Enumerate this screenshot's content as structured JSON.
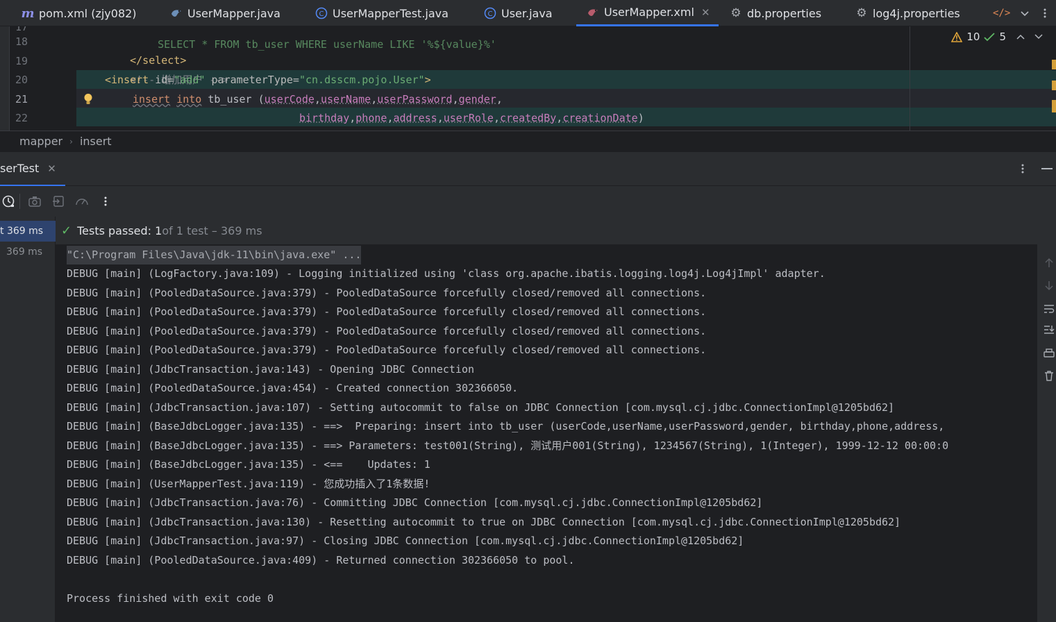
{
  "tabs": [
    {
      "label": "pom.xml (zjy082)",
      "icon": "maven-m-icon"
    },
    {
      "label": "UserMapper.java",
      "icon": "mybatis-bird-icon"
    },
    {
      "label": "UserMapperTest.java",
      "icon": "class-c-icon"
    },
    {
      "label": "User.java",
      "icon": "class-c-icon"
    },
    {
      "label": "UserMapper.xml",
      "icon": "mybatis-bird-icon",
      "active": true
    },
    {
      "label": "db.properties",
      "icon": "gear-icon"
    },
    {
      "label": "log4j.properties",
      "icon": "gear-icon"
    }
  ],
  "editor": {
    "inspections": {
      "warnings": "10",
      "checks": "5"
    },
    "line_numbers": [
      "17",
      "18",
      "19",
      "20",
      "21",
      "22"
    ],
    "lines": {
      "l17": "SELECT * FROM tb_user WHERE userName LIKE '%${value}%'",
      "l18_tag": "</select>",
      "l19_comment": "<!-- 增加用户 -->",
      "l20_open": "<insert ",
      "l20_attr1": "id=",
      "l20_val1": "\"add\"",
      "l20_attr2": " parameterType=",
      "l20_val2": "\"cn.dsscm.pojo.User\"",
      "l20_close": ">",
      "l21_kw1": "insert",
      "l21_kw2": "into",
      "l21_table": " tb_user (",
      "l21_c1": "userCode",
      "l21_c2": "userName",
      "l21_c3": "userPassword",
      "l21_c4": "gender",
      "l22_c1": "birthday",
      "l22_c2": "phone",
      "l22_c3": "address",
      "l22_c4": "userRole",
      "l22_c5": "createdBy",
      "l22_c6": "creationDate"
    }
  },
  "breadcrumb": [
    "mapper",
    "insert"
  ],
  "run": {
    "tab_label": "serTest",
    "tree": [
      {
        "label": "t 369 ms"
      },
      {
        "label": "369 ms"
      }
    ],
    "status": {
      "passed": "Tests passed: 1",
      "detail": " of 1 test – 369 ms"
    },
    "console": [
      "\"C:\\Program Files\\Java\\jdk-11\\bin\\java.exe\" ...",
      "DEBUG [main] (LogFactory.java:109) - Logging initialized using 'class org.apache.ibatis.logging.log4j.Log4jImpl' adapter.",
      "DEBUG [main] (PooledDataSource.java:379) - PooledDataSource forcefully closed/removed all connections.",
      "DEBUG [main] (PooledDataSource.java:379) - PooledDataSource forcefully closed/removed all connections.",
      "DEBUG [main] (PooledDataSource.java:379) - PooledDataSource forcefully closed/removed all connections.",
      "DEBUG [main] (PooledDataSource.java:379) - PooledDataSource forcefully closed/removed all connections.",
      "DEBUG [main] (JdbcTransaction.java:143) - Opening JDBC Connection",
      "DEBUG [main] (PooledDataSource.java:454) - Created connection 302366050.",
      "DEBUG [main] (JdbcTransaction.java:107) - Setting autocommit to false on JDBC Connection [com.mysql.cj.jdbc.ConnectionImpl@1205bd62]",
      "DEBUG [main] (BaseJdbcLogger.java:135) - ==>  Preparing: insert into tb_user (userCode,userName,userPassword,gender, birthday,phone,address,",
      "DEBUG [main] (BaseJdbcLogger.java:135) - ==> Parameters: test001(String), 测试用户001(String), 1234567(String), 1(Integer), 1999-12-12 00:00:0",
      "DEBUG [main] (BaseJdbcLogger.java:135) - <==    Updates: 1",
      "DEBUG [main] (UserMapperTest.java:119) - 您成功插入了1条数据!",
      "DEBUG [main] (JdbcTransaction.java:76) - Committing JDBC Connection [com.mysql.cj.jdbc.ConnectionImpl@1205bd62]",
      "DEBUG [main] (JdbcTransaction.java:130) - Resetting autocommit to true on JDBC Connection [com.mysql.cj.jdbc.ConnectionImpl@1205bd62]",
      "DEBUG [main] (JdbcTransaction.java:97) - Closing JDBC Connection [com.mysql.cj.jdbc.ConnectionImpl@1205bd62]",
      "DEBUG [main] (PooledDataSource.java:409) - Returned connection 302366050 to pool.",
      "",
      "Process finished with exit code 0"
    ]
  },
  "colors": {
    "accent": "#3574f0",
    "pass": "#5fb865",
    "warn": "#e0a53a"
  }
}
